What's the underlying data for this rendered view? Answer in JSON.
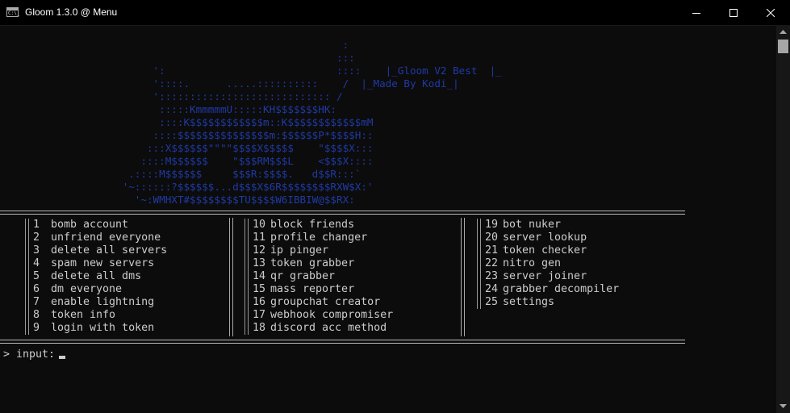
{
  "window": {
    "title": "Gloom 1.3.0 @ Menu",
    "icon": "console-icon",
    "icon_text": "C:\\_"
  },
  "ascii_art": "                                                        :\n                                                       :::\n                         ':                            ::::    |_Gloom V2 Best  |_\n                         '::::.      .....::::::::::    /  |_Made By Kodi_|\n                         ':::::::::::::::::::::::::::: /\n                          :::::KmmmmmU:::::KH$$$$$$$HK:\n                          ::::K$$$$$$$$$$$$m::K$$$$$$$$$$$$mM\n                         ::::$$$$$$$$$$$$$$$m:$$$$$$P*$$$$H::\n                        :::X$$$$$$\"\"\"\"$$$$X$$$$$    \"$$$$X:::\n                       ::::M$$$$$$    \"$$$RM$$$L    <$$$X::::\n                     .::::M$$$$$$     $$$R:$$$$.   d$$R:::`\n                    '~::::::?$$$$$$...d$$$X$6R$$$$$$$$RXW$X:'\n                      '~:WMHXT#$$$$$$$$TU$$$$W6IBBIW@$$RX:",
  "menu": {
    "columns": [
      {
        "items": [
          {
            "num": "1",
            "label": "bomb account"
          },
          {
            "num": "2",
            "label": "unfriend everyone"
          },
          {
            "num": "3",
            "label": "delete all servers"
          },
          {
            "num": "4",
            "label": "spam new servers"
          },
          {
            "num": "5",
            "label": "delete all dms"
          },
          {
            "num": "6",
            "label": "dm everyone"
          },
          {
            "num": "7",
            "label": "enable lightning"
          },
          {
            "num": "8",
            "label": "token info"
          },
          {
            "num": "9",
            "label": "login with token"
          }
        ]
      },
      {
        "items": [
          {
            "num": "10",
            "label": "block friends"
          },
          {
            "num": "11",
            "label": "profile changer"
          },
          {
            "num": "12",
            "label": "ip pinger"
          },
          {
            "num": "13",
            "label": "token grabber"
          },
          {
            "num": "14",
            "label": "qr grabber"
          },
          {
            "num": "15",
            "label": "mass reporter"
          },
          {
            "num": "16",
            "label": "groupchat creator"
          },
          {
            "num": "17",
            "label": "webhook compromiser"
          },
          {
            "num": "18",
            "label": "discord acc method"
          }
        ]
      },
      {
        "items": [
          {
            "num": "19",
            "label": "bot nuker"
          },
          {
            "num": "20",
            "label": "server lookup"
          },
          {
            "num": "21",
            "label": "token checker"
          },
          {
            "num": "22",
            "label": "nitro gen"
          },
          {
            "num": "23",
            "label": "server joiner"
          },
          {
            "num": "24",
            "label": "grabber decompiler"
          },
          {
            "num": "25",
            "label": "settings"
          }
        ]
      }
    ]
  },
  "prompt": {
    "text": "> input: "
  },
  "colors": {
    "background": "#0c0c0c",
    "text": "#cccccc",
    "ascii_art": "#1f3aa5"
  }
}
